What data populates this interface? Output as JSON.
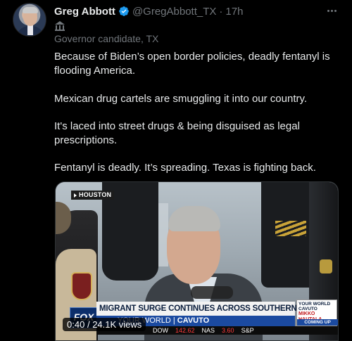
{
  "author": {
    "name": "Greg Abbott",
    "handle": "@GregAbbott_TX",
    "separator": "·",
    "time": "17h",
    "label": "Governor candidate, TX"
  },
  "tweet": {
    "paragraphs": [
      "Because of Biden’s open border policies, deadly fentanyl is flooding America.",
      "Mexican drug cartels are smuggling it into our country.",
      "It's laced into street drugs & being disguised as legal prescriptions.",
      "Fentanyl is deadly. It’s spreading. Texas is fighting back."
    ]
  },
  "video": {
    "location_tag": "HOUSTON",
    "network_logo": "FOX",
    "headline": "MIGRANT SURGE CONTINUES ACROSS SOUTHERN BORDER",
    "show_prefix": "YOUR WORLD",
    "show_name": "CAVUTO",
    "ticker": [
      {
        "symbol": "DOW",
        "value": "",
        "negative": false
      },
      {
        "symbol": "",
        "value": "142.62",
        "negative": true
      },
      {
        "symbol": "NAS",
        "value": "",
        "negative": false
      },
      {
        "symbol": "",
        "value": "3.60",
        "negative": true
      },
      {
        "symbol": "S&P",
        "value": "",
        "negative": false
      }
    ],
    "promo": {
      "title": "YOUR WORLD CAVUTO",
      "subtitle": "MIKKO HAUTALA",
      "footer": "COMING UP"
    },
    "duration": "0:40",
    "views": "24.1K views",
    "info_separator": "/"
  },
  "colors": {
    "background": "#000000",
    "text": "#e7e9ea",
    "muted": "#71767b",
    "verified": "#1d9bf0",
    "fox_blue": "#1b4aa0"
  },
  "icons": {
    "verified": "verified-badge-icon",
    "government": "government-building-icon",
    "more": "more-options-icon"
  }
}
